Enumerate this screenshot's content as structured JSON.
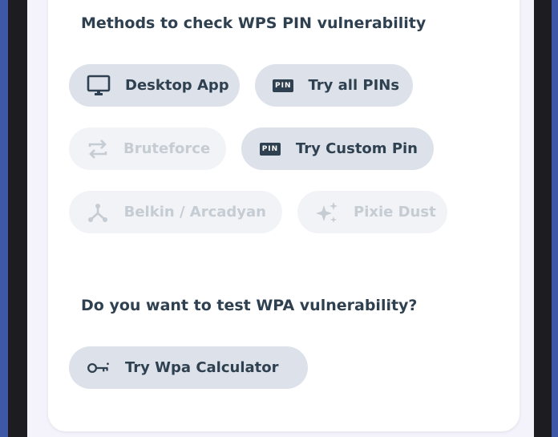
{
  "sections": {
    "wps_title": "Methods to check WPS PIN vulnerability",
    "wpa_title": "Do you want to test WPA vulnerability?"
  },
  "methods": {
    "desktop_app": {
      "label": "Desktop App",
      "icon": "monitor-icon",
      "enabled": true
    },
    "try_all_pins": {
      "label": "Try all PINs",
      "icon": "pin-badge-icon",
      "badge": "PIN",
      "enabled": true
    },
    "bruteforce": {
      "label": "Bruteforce",
      "icon": "swap-arrows-icon",
      "enabled": false
    },
    "try_custom_pin": {
      "label": "Try Custom Pin",
      "icon": "pin-badge-icon",
      "badge": "PIN",
      "enabled": true
    },
    "belkin_arcadyan": {
      "label": "Belkin / Arcadyan",
      "icon": "network-branch-icon",
      "enabled": false
    },
    "pixie_dust": {
      "label": "Pixie Dust",
      "icon": "sparkles-icon",
      "enabled": false
    }
  },
  "wpa": {
    "calculator": {
      "label": "Try Wpa Calculator",
      "icon": "key-icon",
      "enabled": true
    }
  },
  "colors": {
    "chip_enabled_bg": "#dde2ea",
    "chip_disabled_bg": "#f1f3f6",
    "text_primary": "#2f4150",
    "text_disabled": "#c6ccd3",
    "screen_bg": "#f4f2fb",
    "card_bg": "#ffffff"
  }
}
